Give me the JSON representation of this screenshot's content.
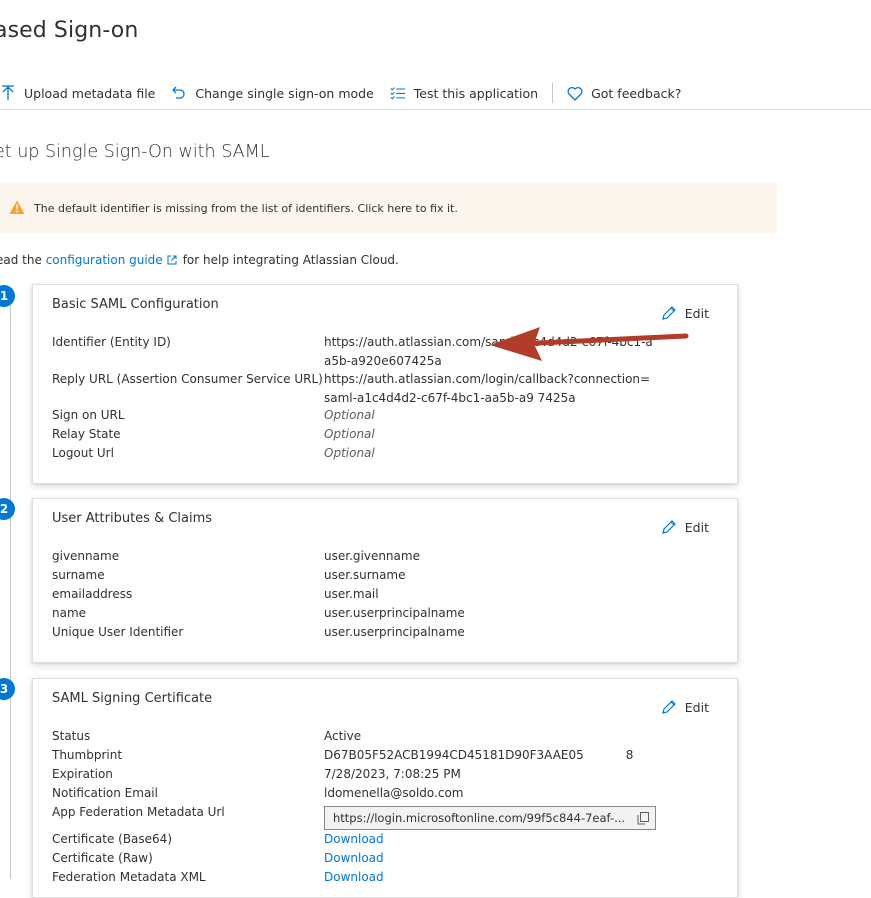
{
  "page": {
    "title": "ased Sign-on",
    "subtitle": "et up Single Sign-On with SAML"
  },
  "toolbar": {
    "upload_label": "Upload metadata file",
    "change_label": "Change single sign-on mode",
    "test_label": "Test this application",
    "feedback_label": "Got feedback?"
  },
  "warning": {
    "text": "The default identifier is missing from the list of identifiers. Click here to fix it."
  },
  "readline": {
    "prefix": "ead the",
    "link": "configuration guide",
    "suffix": "for help integrating Atlassian Cloud."
  },
  "edit_label": "Edit",
  "sections": [
    {
      "step": "1",
      "title": "Basic SAML Configuration",
      "rows": [
        {
          "key": "Identifier (Entity ID)",
          "value": "https://auth.atlassian.com/saml/a1c4d4d2-c67f-4bc1-aa5b-a920e607425a"
        },
        {
          "key": "Reply URL (Assertion Consumer Service URL)",
          "value": "https://auth.atlassian.com/login/callback?connection=saml-a1c4d4d2-c67f-4bc1-aa5b-a9      7425a"
        },
        {
          "key": "Sign on URL",
          "value": "Optional"
        },
        {
          "key": "Relay State",
          "value": "Optional"
        },
        {
          "key": "Logout Url",
          "value": "Optional"
        }
      ]
    },
    {
      "step": "2",
      "title": "User Attributes & Claims",
      "rows": [
        {
          "key": "givenname",
          "value": "user.givenname"
        },
        {
          "key": "surname",
          "value": "user.surname"
        },
        {
          "key": "emailaddress",
          "value": "user.mail"
        },
        {
          "key": "name",
          "value": "user.userprincipalname"
        },
        {
          "key": "Unique User Identifier",
          "value": "user.userprincipalname"
        }
      ]
    },
    {
      "step": "3",
      "title": "SAML Signing Certificate",
      "rows": [
        {
          "key": "Status",
          "value": "Active"
        },
        {
          "key": "Thumbprint",
          "value": "D67B05F52ACB1994CD45181D90F3AAE05           8"
        },
        {
          "key": "Expiration",
          "value": "7/28/2023, 7:08:25 PM"
        },
        {
          "key": "Notification Email",
          "value": "ldomenella@soldo.com"
        },
        {
          "key": "App Federation Metadata Url",
          "value": "https://login.microsoftonline.com/99f5c844-7eaf-..."
        },
        {
          "key": "Certificate (Base64)",
          "value": "Download"
        },
        {
          "key": "Certificate (Raw)",
          "value": "Download"
        },
        {
          "key": "Federation Metadata XML",
          "value": "Download"
        }
      ]
    }
  ],
  "colors": {
    "accent": "#0078d4",
    "warning_bg": "#fdf6ef",
    "warning_icon": "#f7a233",
    "arrow": "#b23c2a"
  }
}
